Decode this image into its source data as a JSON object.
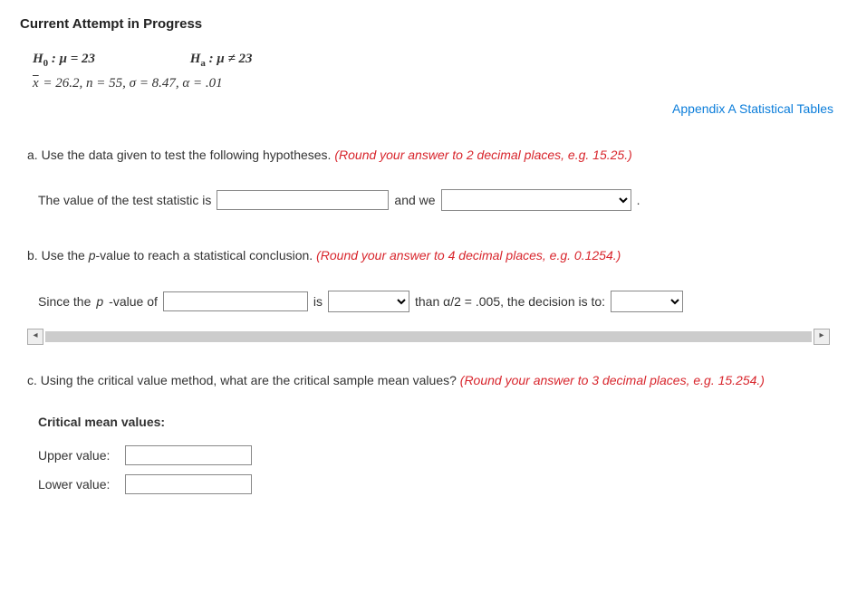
{
  "title": "Current Attempt in Progress",
  "hypotheses": {
    "h0_prefix": "H",
    "h0_sub": "0",
    "h0_body": " : μ = 23",
    "ha_prefix": "H",
    "ha_sub": "a",
    "ha_body": " : μ ≠ 23",
    "stats_line_xbar": "x",
    "stats_line_rest": " = 26.2,  n = 55,  σ = 8.47,  α = .01"
  },
  "appendix_link": "Appendix A Statistical Tables",
  "partA": {
    "label": "a. ",
    "text": "Use the data given to test the following hypotheses. ",
    "hint": "(Round your answer to 2 decimal places, e.g. 15.25.)",
    "stat_label": "The value of the test statistic is",
    "and_we": "and we",
    "period": "."
  },
  "partB": {
    "label": "b. ",
    "text_before_p": "Use the ",
    "p_word": "p",
    "text_after_p": "-value to reach a statistical conclusion. ",
    "hint": "(Round your answer to 4 decimal places, e.g. 0.1254.)",
    "since_before_p": "Since the ",
    "since_after_p": "-value of",
    "is": "is",
    "than_text": "than α/2 = .005, the decision is to:"
  },
  "partC": {
    "label": "c. ",
    "text": "Using the critical value method, what are the critical sample mean values? ",
    "hint": "(Round your answer to 3 decimal places, e.g. 15.254.)",
    "heading": "Critical mean values:",
    "upper": "Upper value:",
    "lower": "Lower value:"
  },
  "scroll": {
    "left": "◂",
    "right": "▸"
  }
}
